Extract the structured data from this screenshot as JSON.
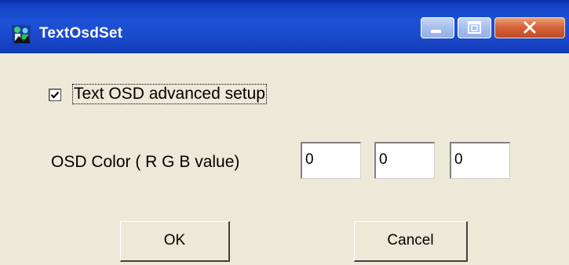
{
  "window": {
    "title": "TextOsdSet"
  },
  "titlebar": {
    "icons": {
      "app": "app-icon",
      "minimize": "minimize-icon",
      "maximize": "maximize-icon",
      "close": "close-icon"
    }
  },
  "form": {
    "advanced_setup": {
      "label": "Text OSD advanced setup",
      "checked": true
    },
    "osd_color": {
      "label": "OSD Color ( R G B value)",
      "r": "0",
      "g": "0",
      "b": "0"
    }
  },
  "buttons": {
    "ok": "OK",
    "cancel": "Cancel"
  },
  "colors": {
    "titlebar": "#1d52d6",
    "dialog_background": "#ece9d8",
    "close_button": "#d7643b"
  }
}
